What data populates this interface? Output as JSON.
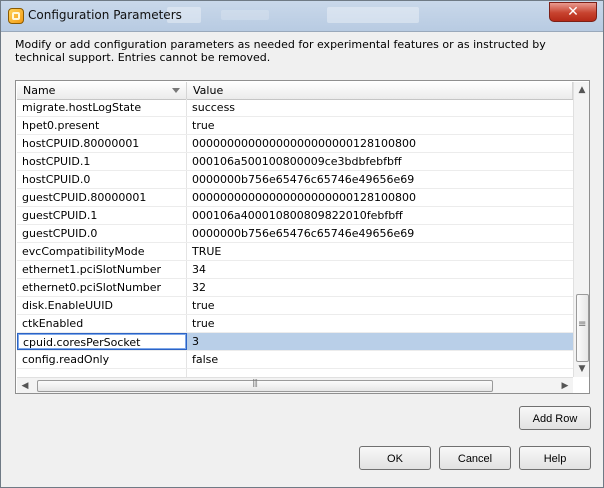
{
  "window": {
    "title": "Configuration Parameters",
    "close_label": "✕",
    "description": "Modify or add configuration parameters as needed for experimental features or as instructed by technical support. Entries cannot be removed."
  },
  "table": {
    "columns": [
      "Name",
      "Value"
    ],
    "rows": [
      {
        "name": "migrate.hostLogState",
        "value": "success"
      },
      {
        "name": "hpet0.present",
        "value": "true"
      },
      {
        "name": "hostCPUID.80000001",
        "value": "00000000000000000000000128100800"
      },
      {
        "name": "hostCPUID.1",
        "value": "000106a500100800009ce3bdbfebfbff"
      },
      {
        "name": "hostCPUID.0",
        "value": "0000000b756e65476c65746e49656e69"
      },
      {
        "name": "guestCPUID.80000001",
        "value": "00000000000000000000000128100800"
      },
      {
        "name": "guestCPUID.1",
        "value": "000106a400010800809822010febfbff"
      },
      {
        "name": "guestCPUID.0",
        "value": "0000000b756e65476c65746e49656e69"
      },
      {
        "name": "evcCompatibilityMode",
        "value": "TRUE"
      },
      {
        "name": "ethernet1.pciSlotNumber",
        "value": "34"
      },
      {
        "name": "ethernet0.pciSlotNumber",
        "value": "32"
      },
      {
        "name": "disk.EnableUUID",
        "value": "true"
      },
      {
        "name": "ctkEnabled",
        "value": "true"
      },
      {
        "name": "cpuid.coresPerSocket",
        "value": "3"
      },
      {
        "name": "config.readOnly",
        "value": "false"
      },
      {
        "name": "",
        "value": ""
      }
    ],
    "selected_row": "cpuid.coresPerSocket",
    "scroll_up_icon": "▲",
    "scroll_down_icon": "▼",
    "scroll_left_icon": "◀",
    "scroll_right_icon": "▶"
  },
  "buttons": {
    "add_row": "Add Row",
    "ok": "OK",
    "cancel": "Cancel",
    "help": "Help"
  },
  "icons": {
    "app": "vmware-icon",
    "close": "close-icon"
  }
}
